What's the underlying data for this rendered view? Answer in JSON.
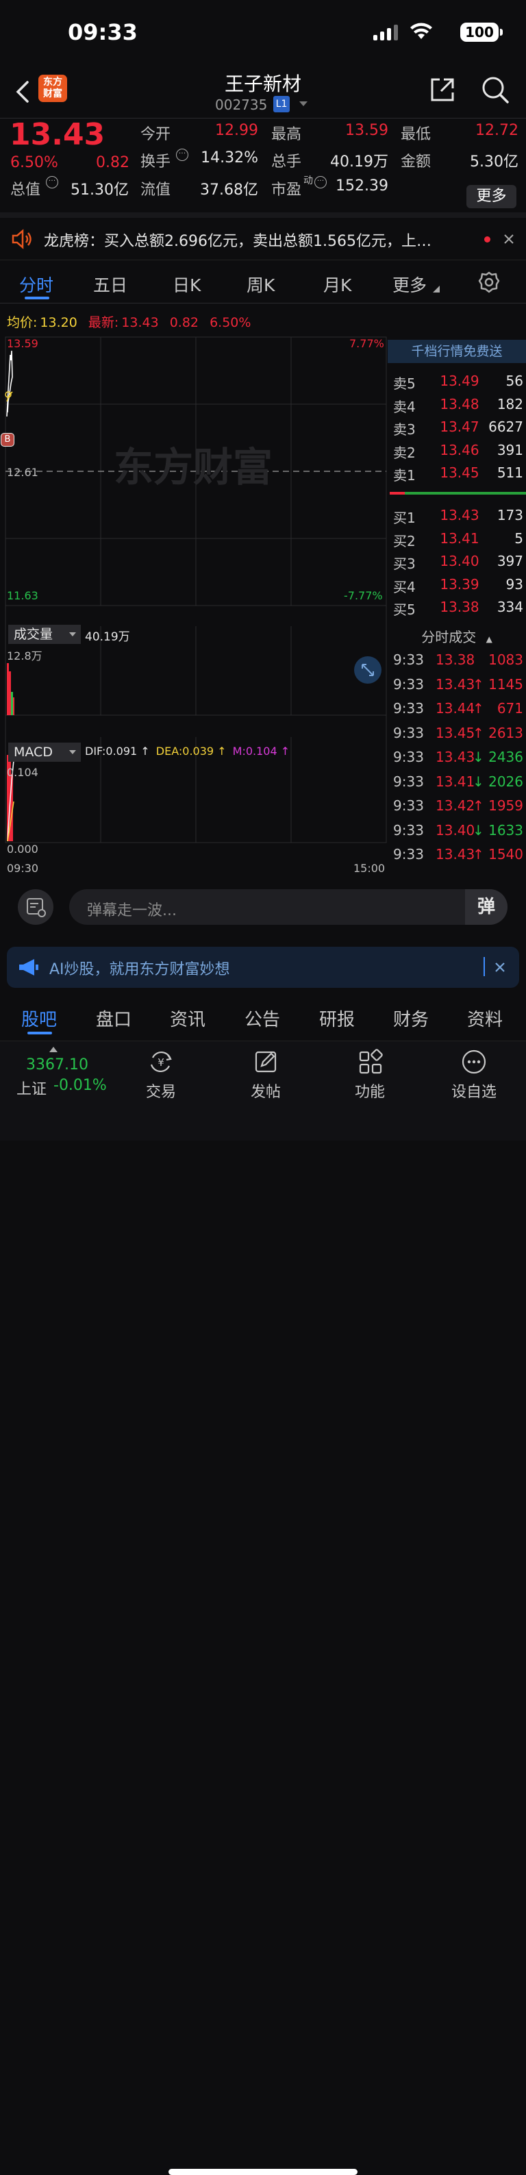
{
  "status_bar": {
    "time": "09:33",
    "battery": "100"
  },
  "header": {
    "title": "王子新材",
    "code": "002735",
    "level_badge": "L1",
    "logo_text_line1": "东方",
    "logo_text_line2": "财富"
  },
  "quote": {
    "price": "13.43",
    "change_pct": "6.50%",
    "change": "0.82",
    "open_label": "今开",
    "open": "12.99",
    "high_label": "最高",
    "high": "13.59",
    "low_label": "最低",
    "low": "12.72",
    "turnover_label": "换手",
    "turnover": "14.32%",
    "volume_label": "总手",
    "volume": "40.19万",
    "amount_label": "金额",
    "amount": "5.30亿",
    "mktcap_label": "总值",
    "mktcap": "51.30亿",
    "float_label": "流值",
    "float": "37.68亿",
    "pe_label": "市盈",
    "pe_sup": "动",
    "pe": "152.39",
    "more_label": "更多"
  },
  "news": {
    "text": "龙虎榜：买入总额2.696亿元，卖出总额1.565亿元，上…"
  },
  "tabs": [
    "分时",
    "五日",
    "日K",
    "周K",
    "月K",
    "更多"
  ],
  "avgline": {
    "avg_label": "均价:",
    "avg": "13.20",
    "latest_label": "最新:",
    "latest": "13.43",
    "chg": "0.82",
    "pct": "6.50%"
  },
  "chart": {
    "top_price": "13.59",
    "top_pct": "7.77%",
    "mid_price": "12.61",
    "bottom_price": "11.63",
    "bottom_pct": "-7.77%",
    "watermark": "东方财富",
    "b_marker": "B",
    "volume_label": "成交量",
    "volume_value": "40.19万",
    "volume_max": "12.8万",
    "macd_label": "MACD",
    "dif": "DIF:0.091",
    "dea": "DEA:0.039",
    "m": "M:0.104",
    "macd_max": "0.104",
    "macd_min": "0.000",
    "time_start": "09:30",
    "time_end": "15:00"
  },
  "orderbook": {
    "promo": "千档行情免费送",
    "asks": [
      {
        "label": "卖5",
        "price": "13.49",
        "qty": "56"
      },
      {
        "label": "卖4",
        "price": "13.48",
        "qty": "182"
      },
      {
        "label": "卖3",
        "price": "13.47",
        "qty": "6627"
      },
      {
        "label": "卖2",
        "price": "13.46",
        "qty": "391"
      },
      {
        "label": "卖1",
        "price": "13.45",
        "qty": "511"
      }
    ],
    "bids": [
      {
        "label": "买1",
        "price": "13.43",
        "qty": "173"
      },
      {
        "label": "买2",
        "price": "13.41",
        "qty": "5"
      },
      {
        "label": "买3",
        "price": "13.40",
        "qty": "397"
      },
      {
        "label": "买4",
        "price": "13.39",
        "qty": "93"
      },
      {
        "label": "买5",
        "price": "13.38",
        "qty": "334"
      }
    ]
  },
  "trades": {
    "title": "分时成交",
    "rows": [
      {
        "time": "9:33",
        "price": "13.38",
        "arrow": "",
        "qty": "1083",
        "dir": "red"
      },
      {
        "time": "9:33",
        "price": "13.43",
        "arrow": "↑",
        "qty": "1145",
        "dir": "red"
      },
      {
        "time": "9:33",
        "price": "13.44",
        "arrow": "↑",
        "qty": "671",
        "dir": "red"
      },
      {
        "time": "9:33",
        "price": "13.45",
        "arrow": "↑",
        "qty": "2613",
        "dir": "red"
      },
      {
        "time": "9:33",
        "price": "13.43",
        "arrow": "↓",
        "qty": "2436",
        "dir": "green"
      },
      {
        "time": "9:33",
        "price": "13.41",
        "arrow": "↓",
        "qty": "2026",
        "dir": "green"
      },
      {
        "time": "9:33",
        "price": "13.42",
        "arrow": "↑",
        "qty": "1959",
        "dir": "red"
      },
      {
        "time": "9:33",
        "price": "13.40",
        "arrow": "↓",
        "qty": "1633",
        "dir": "green"
      },
      {
        "time": "9:33",
        "price": "13.43",
        "arrow": "↑",
        "qty": "1540",
        "dir": "red"
      }
    ]
  },
  "danmu": {
    "placeholder": "弹幕走一波...",
    "send_icon_text": "弹"
  },
  "ai_banner": {
    "text": "AI炒股，就用东方财富妙想"
  },
  "subtabs": [
    "股吧",
    "盘口",
    "资讯",
    "公告",
    "研报",
    "财务",
    "资料"
  ],
  "bottom_nav": {
    "index_value": "3367.10",
    "index_name": "上证",
    "index_change": "-0.01%",
    "items": [
      "交易",
      "发帖",
      "功能",
      "设自选"
    ]
  }
}
